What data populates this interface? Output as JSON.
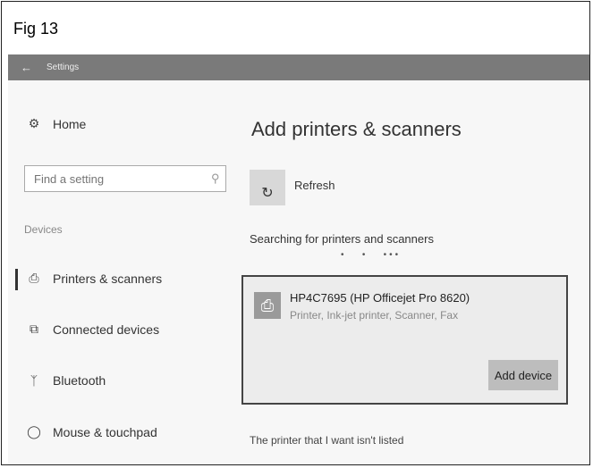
{
  "figure": {
    "caption": "Fig 13"
  },
  "window": {
    "title": "Settings",
    "back_icon": "back-arrow-icon"
  },
  "sidebar": {
    "home": {
      "label": "Home",
      "icon": "gear-icon"
    },
    "search": {
      "placeholder": "Find a setting",
      "icon": "search-icon"
    },
    "section_label": "Devices",
    "items": [
      {
        "label": "Printers & scanners",
        "icon": "printer-icon",
        "active": true
      },
      {
        "label": "Connected devices",
        "icon": "connected-devices-icon",
        "active": false
      },
      {
        "label": "Bluetooth",
        "icon": "bluetooth-icon",
        "active": false
      },
      {
        "label": "Mouse & touchpad",
        "icon": "mouse-icon",
        "active": false
      }
    ]
  },
  "main": {
    "title": "Add printers & scanners",
    "refresh": {
      "label": "Refresh",
      "icon": "refresh-icon"
    },
    "searching_text": "Searching for printers and scanners",
    "device": {
      "name": "HP4C7695 (HP Officejet Pro 8620)",
      "description": "Printer, Ink-jet printer, Scanner, Fax",
      "icon": "printer-icon",
      "add_button": "Add device"
    },
    "not_listed_link": "The printer that I want isn't listed"
  },
  "colors": {
    "titlebar": "#7a7a7a",
    "content_bg": "#f7f7f7",
    "card_bg": "#ececec",
    "button_bg": "#bdbdbd"
  }
}
